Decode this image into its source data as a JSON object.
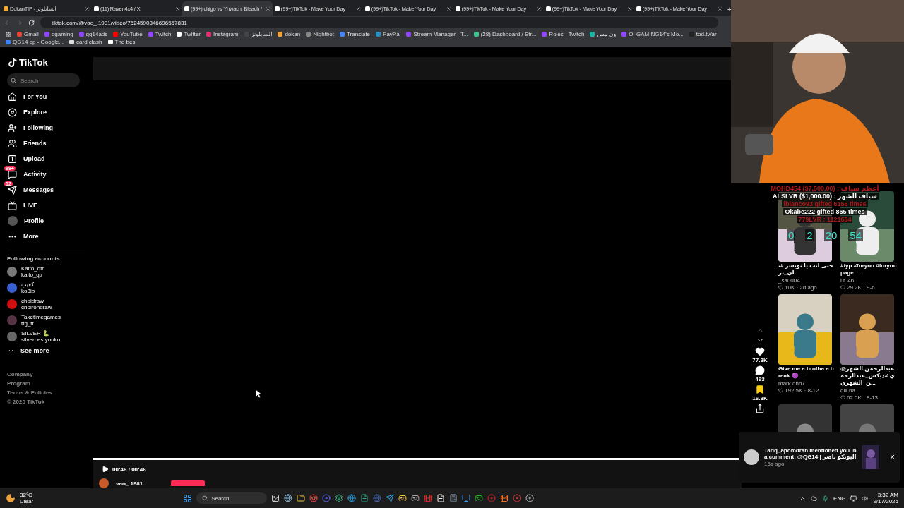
{
  "browser": {
    "tabs": [
      {
        "title": "DokanTIP - السايلونز",
        "selected": false
      },
      {
        "title": "(11) Raven4x4 / X",
        "selected": false
      },
      {
        "title": "(99+)Ichigo vs Yhwach: Bleach /",
        "selected": true
      },
      {
        "title": "(99+)TikTok - Make Your Day",
        "selected": false
      },
      {
        "title": "(99+)TikTok - Make Your Day",
        "selected": false
      },
      {
        "title": "(99+)TikTok - Make Your Day",
        "selected": false
      },
      {
        "title": "(99+)TikTok - Make Your Day",
        "selected": false
      },
      {
        "title": "(99+)TikTok - Make Your Day",
        "selected": false
      }
    ],
    "new_tab": "+",
    "address": "tiktok.com/@vao_.1981/video/7524590846696557831",
    "bookmarks": [
      "Gmail",
      "qgaming",
      "qg14ads",
      "YouTube",
      "Twitch",
      "Twitter",
      "Instagram",
      "السايلونز",
      "dokan",
      "Nightbot",
      "Translate",
      "PayPal",
      "Stream Manager - T...",
      "(28) Dashboard / Str...",
      "Roles - Twitch",
      "ون بيس",
      "Q_GAMING14's Mo...",
      "tod.tv/ar",
      "QG14 ep - Google...",
      "card clash",
      "The bes"
    ]
  },
  "sidebar": {
    "logo": "TikTok",
    "search": {
      "placeholder": "Search"
    },
    "nav": [
      {
        "kind": "home",
        "label": "For You"
      },
      {
        "kind": "explore",
        "label": "Explore"
      },
      {
        "kind": "following",
        "label": "Following"
      },
      {
        "kind": "friends",
        "label": "Friends"
      },
      {
        "kind": "upload",
        "label": "Upload"
      },
      {
        "kind": "activity",
        "label": "Activity",
        "badge": "99+"
      },
      {
        "kind": "messages",
        "label": "Messages",
        "badge": "52"
      },
      {
        "kind": "live",
        "label": "LIVE"
      },
      {
        "kind": "profile",
        "label": "Profile"
      },
      {
        "kind": "more",
        "label": "More"
      }
    ],
    "following_title": "Following accounts",
    "accounts": [
      {
        "name": "Kaito_qtr",
        "handle": "kaito_qtr"
      },
      {
        "name": "كعيب",
        "handle": "ko3ib"
      },
      {
        "name": "choidraw",
        "handle": "choirondraw"
      },
      {
        "name": "Taketimegames",
        "handle": "ttg_tt"
      },
      {
        "name": "SILVER 🐍",
        "handle": "silverbestyonko"
      }
    ],
    "see_more": "See more",
    "footer": [
      "Company",
      "Program",
      "Terms & Policies",
      "© 2025 TikTok"
    ]
  },
  "player": {
    "progress": {
      "level": 1
    },
    "time": "00:46 / 00:46",
    "author": "vao_.1981"
  },
  "actions": [
    {
      "kind": "up"
    },
    {
      "kind": "down"
    },
    {
      "kind": "like",
      "on": false,
      "count": "77.8K"
    },
    {
      "kind": "comment",
      "count": "493"
    },
    {
      "kind": "save",
      "on": true,
      "count": "16.8K"
    },
    {
      "kind": "share"
    }
  ],
  "recommended": [
    {
      "kind": "video",
      "caption": "حتى انت يا نويسر #تاي_بر",
      "author": "_sa0004",
      "likes": "10K · 2d ago"
    },
    {
      "kind": "video",
      "caption": "#fyp #foryou #foryoupage ...",
      "author": "l.t.l46",
      "likes": "29.2K · 9-6"
    },
    {
      "kind": "video",
      "caption": "Give me a brotha a break 🟣 ...",
      "author": "mark.ohh7",
      "likes": "192.5K · 8-12"
    },
    {
      "kind": "video",
      "caption": "@عبدالرحمن الشهري #ديكس_عبدالرحمن_الشهري...",
      "author": "dill.na",
      "likes": "62.5K · 8-13"
    },
    {
      "kind": "picture"
    },
    {
      "kind": "picture"
    }
  ],
  "stream_overlay": {
    "lines": [
      {
        "text": "MOHD454 ($7,500.00) : أعظم سياف",
        "color": "#b01818"
      },
      {
        "text": "ALSLVR ($1,000.00) : سياف الشهر",
        "color": "#ffffff"
      },
      {
        "text": "ibianco93 gifted 6155 times",
        "color": "#b01818"
      },
      {
        "text": "Okabe222 gifted 865 times",
        "color": "#ffffff"
      },
      {
        "text": "779LVR : 1121654",
        "color": "#b01818"
      }
    ],
    "timer": [
      "0",
      "2",
      "20",
      "54"
    ]
  },
  "notification": {
    "text": "Tariq_apomdrah mentioned you in a comment: @QG14 | اليونكو ناصر",
    "time": "15s ago",
    "close": "×"
  },
  "taskbar": {
    "temperature": "32°C",
    "weather": "Clear",
    "search": "Search",
    "language": "ENG",
    "time": "3:32 AM",
    "date": "9/17/2025"
  }
}
